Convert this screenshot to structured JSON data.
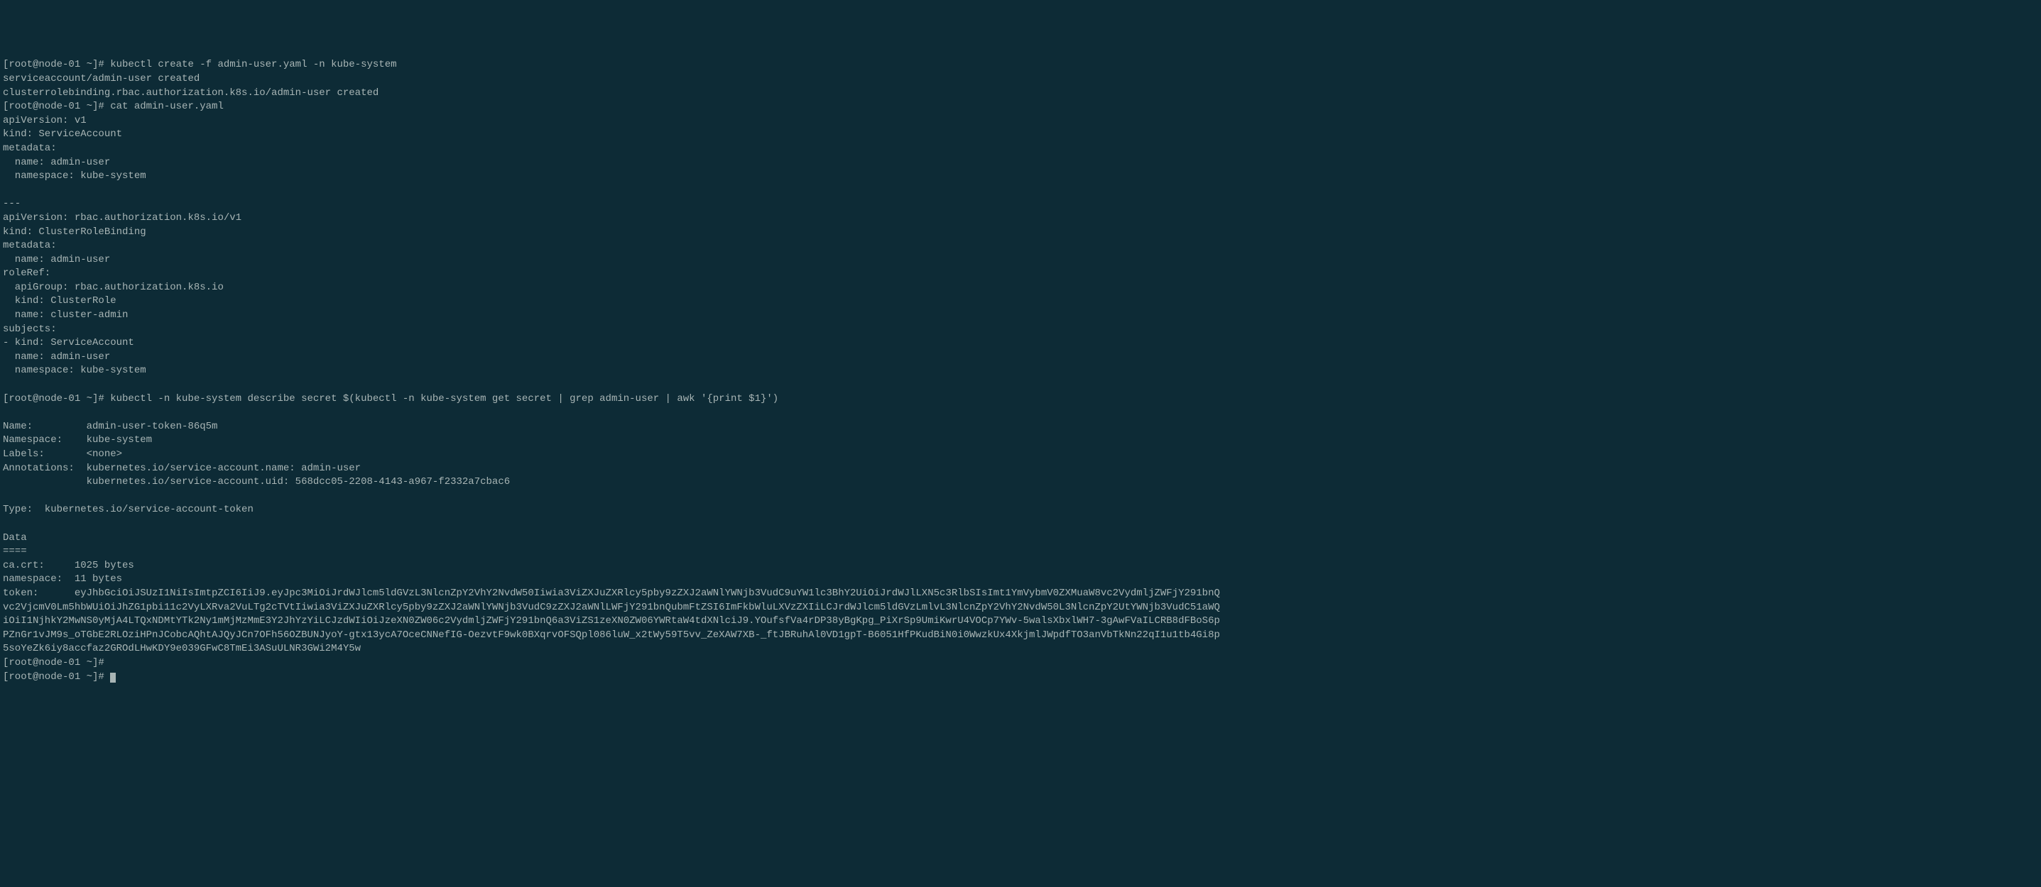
{
  "terminal": {
    "lines": [
      "[root@node-01 ~]# kubectl create -f admin-user.yaml -n kube-system",
      "serviceaccount/admin-user created",
      "clusterrolebinding.rbac.authorization.k8s.io/admin-user created",
      "[root@node-01 ~]# cat admin-user.yaml",
      "apiVersion: v1",
      "kind: ServiceAccount",
      "metadata:",
      "  name: admin-user",
      "  namespace: kube-system",
      "",
      "---",
      "apiVersion: rbac.authorization.k8s.io/v1",
      "kind: ClusterRoleBinding",
      "metadata:",
      "  name: admin-user",
      "roleRef:",
      "  apiGroup: rbac.authorization.k8s.io",
      "  kind: ClusterRole",
      "  name: cluster-admin",
      "subjects:",
      "- kind: ServiceAccount",
      "  name: admin-user",
      "  namespace: kube-system",
      "",
      "[root@node-01 ~]# kubectl -n kube-system describe secret $(kubectl -n kube-system get secret | grep admin-user | awk '{print $1}')",
      "",
      "Name:         admin-user-token-86q5m",
      "Namespace:    kube-system",
      "Labels:       <none>",
      "Annotations:  kubernetes.io/service-account.name: admin-user",
      "              kubernetes.io/service-account.uid: 568dcc05-2208-4143-a967-f2332a7cbac6",
      "",
      "Type:  kubernetes.io/service-account-token",
      "",
      "Data",
      "====",
      "ca.crt:     1025 bytes",
      "namespace:  11 bytes",
      "token:      eyJhbGciOiJSUzI1NiIsImtpZCI6IiJ9.eyJpc3MiOiJrdWJlcm5ldGVzL3NlcnZpY2VhY2NvdW50Iiwia3ViZXJuZXRlcy5pby9zZXJ2aWNlYWNjb3VudC9uYW1lc3BhY2UiOiJrdWJlLXN5c3RlbSIsImt1YmVybmV0ZXMuaW8vc2VydmljZWFjY291bnQ",
      "vc2VjcmV0Lm5hbWUiOiJhZG1pbi11c2VyLXRva2VuLTg2cTVtIiwia3ViZXJuZXRlcy5pby9zZXJ2aWNlYWNjb3VudC9zZXJ2aWNlLWFjY291bnQubmFtZSI6ImFkbWluLXVzZXIiLCJrdWJlcm5ldGVzLmlvL3NlcnZpY2VhY2NvdW50L3NlcnZpY2UtYWNjb3VudC51aWQ",
      "iOiI1NjhkY2MwNS0yMjA4LTQxNDMtYTk2Ny1mMjMzMmE3Y2JhYzYiLCJzdWIiOiJzeXN0ZW06c2VydmljZWFjY291bnQ6a3ViZS1zeXN0ZW06YWRtaW4tdXNlciJ9.YOufsfVa4rDP38yBgKpg_PiXrSp9UmiKwrU4VOCp7YWv-5walsXbxlWH7-3gAwFVaILCRB8dFBoS6p",
      "PZnGr1vJM9s_oTGbE2RLOziHPnJCobcAQhtAJQyJCn7OFh56OZBUNJyoY-gtx13ycA7OceCNNefIG-OezvtF9wk0BXqrvOFSQpl086luW_x2tWy59T5vv_ZeXAW7XB-_ftJBRuhAl0VD1gpT-B6051HfPKudBiN0i0WwzkUx4XkjmlJWpdfTO3anVbTkNn22qI1u1tb4Gi8p",
      "5soYeZk6iy8accfaz2GROdLHwKDY9e039GFwC8TmEi3ASuULNR3GWi2M4Y5w",
      "[root@node-01 ~]#",
      "[root@node-01 ~]# "
    ]
  }
}
